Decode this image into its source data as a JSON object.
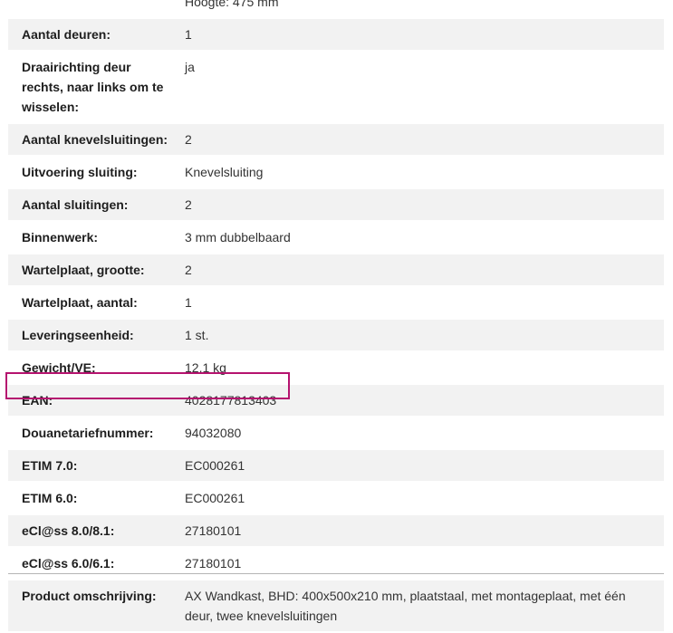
{
  "spec_table": {
    "rows": [
      {
        "label": "",
        "value": "Hoogte: 475 mm"
      },
      {
        "label": "Aantal deuren:",
        "value": "1"
      },
      {
        "label": "Draairichting deur rechts, naar links om te wisselen:",
        "value": "ja"
      },
      {
        "label": "Aantal knevelsluitingen:",
        "value": "2"
      },
      {
        "label": "Uitvoering sluiting:",
        "value": "Knevelsluiting"
      },
      {
        "label": "Aantal sluitingen:",
        "value": "2"
      },
      {
        "label": "Binnenwerk:",
        "value": "3 mm dubbelbaard"
      },
      {
        "label": "Wartelplaat, grootte:",
        "value": "2"
      },
      {
        "label": "Wartelplaat, aantal:",
        "value": "1"
      },
      {
        "label": "Leveringseenheid:",
        "value": "1 st."
      },
      {
        "label": "Gewicht/VE:",
        "value": "12,1 kg"
      },
      {
        "label": "EAN:",
        "value": "4028177813403"
      },
      {
        "label": "Douanetariefnummer:",
        "value": "94032080"
      },
      {
        "label": "ETIM 7.0:",
        "value": "EC000261"
      },
      {
        "label": "ETIM 6.0:",
        "value": "EC000261"
      },
      {
        "label": "eCl@ss 8.0/8.1:",
        "value": "27180101"
      },
      {
        "label": "eCl@ss 6.0/6.1:",
        "value": "27180101"
      },
      {
        "label": "Product omschrijving:",
        "value": "AX Wandkast, BHD: 400x500x210 mm, plaatstaal, met montageplaat, met één deur, twee knevelsluitingen"
      }
    ]
  },
  "colors": {
    "highlight": "#b5136f",
    "row_alt": "#f2f2f2",
    "divider": "#b5b5b5"
  }
}
